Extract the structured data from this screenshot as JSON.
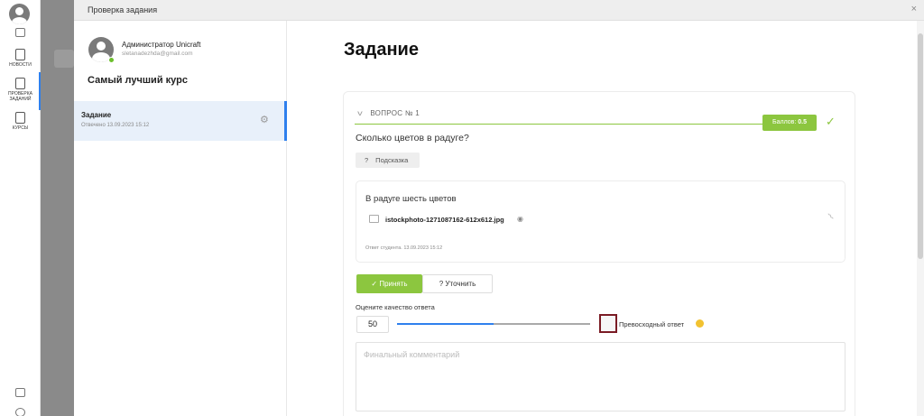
{
  "rail": {
    "items": [
      {
        "label": "НОВОСТИ"
      },
      {
        "label": "ПРОВЕРКА ЗАДАНИЙ"
      },
      {
        "label": "КУРСЫ"
      }
    ]
  },
  "modal": {
    "title": "Проверка задания",
    "close": "×"
  },
  "user": {
    "name": "Администратор Unicraft",
    "email": "sletanadezhda@gmail.com"
  },
  "course": {
    "title": "Самый лучший курс"
  },
  "task": {
    "name": "Задание",
    "status": "Отвечено 13.09.2023 15:12"
  },
  "main": {
    "heading": "Задание"
  },
  "question": {
    "header": "ВОПРОС № 1",
    "score_label": "Баллов:",
    "score_value": "0.5",
    "text": "Сколько цветов в радуге?",
    "hint_label": "Подсказка"
  },
  "answer": {
    "text": "В радуге шесть цветов",
    "file_name": "istockphoto-1271087162-612x612.jpg",
    "meta": "Ответ студента. 13.09.2023 15:12"
  },
  "actions": {
    "accept_label": "Принять",
    "clarify_label": "Уточнить"
  },
  "rating": {
    "label": "Оцените качество ответа",
    "value": "50",
    "slider_fraction": 0.5,
    "excellent_label": "Превосходный ответ"
  },
  "comment": {
    "placeholder": "Финальный комментарий"
  },
  "colors": {
    "accent_green": "#8cc63f",
    "accent_blue": "#2f80ed",
    "highlight_border": "#7a1b24"
  }
}
